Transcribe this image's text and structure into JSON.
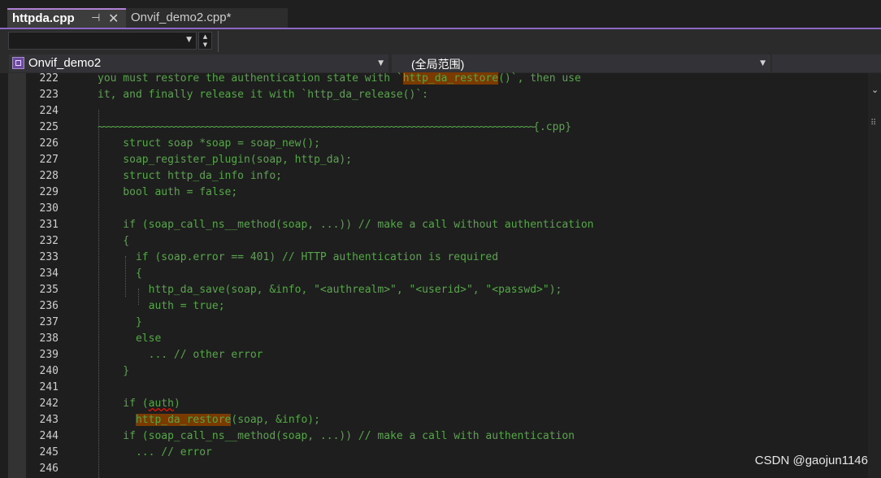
{
  "tabs": [
    {
      "label": "httpda.cpp",
      "active": true,
      "pinned": true
    },
    {
      "label": "Onvif_demo2.cpp*",
      "active": false
    }
  ],
  "icons": {
    "pin": "pin-icon",
    "close": "close-icon",
    "dropdown": "chevron-down-icon",
    "project": "project-icon",
    "spinner": "spinner-icon"
  },
  "navbar": {
    "project": "Onvif_demo2",
    "scope": "(全局范围)"
  },
  "colors": {
    "accent": "#8c67c7",
    "comment_green": "#57a64a",
    "highlight": "#7a3a00",
    "editor_bg": "#1e1e1e"
  },
  "editor": {
    "lines": [
      {
        "n": "222",
        "parts": [
          {
            "t": "you must restore the authentication state with `"
          },
          {
            "t": "http_da_restore",
            "hl": true
          },
          {
            "t": "()`, then use"
          }
        ]
      },
      {
        "n": "223",
        "parts": [
          {
            "t": "it, and finally release it with `http_da_release()`:"
          }
        ]
      },
      {
        "n": "224",
        "parts": [
          {
            "t": ""
          }
        ]
      },
      {
        "n": "225",
        "parts": [
          {
            "t": "~~~~~~~~~~~~~~~~~~~~~~~~~~~~~~~~~~~~~~~~~~~~~~~~~~~~~~~~~~~~~~~~~~~~~~~~~~~~~~~~~~~~~~~~~~~~~~~~~",
            "tilde": true
          },
          {
            "t": "{.cpp}"
          }
        ]
      },
      {
        "n": "226",
        "parts": [
          {
            "t": "    struct soap *soap = soap_new();"
          }
        ]
      },
      {
        "n": "227",
        "parts": [
          {
            "t": "    soap_register_plugin(soap, http_da);"
          }
        ]
      },
      {
        "n": "228",
        "parts": [
          {
            "t": "    struct http_da_info info;"
          }
        ]
      },
      {
        "n": "229",
        "parts": [
          {
            "t": "    bool auth = false;"
          }
        ]
      },
      {
        "n": "230",
        "parts": [
          {
            "t": ""
          }
        ]
      },
      {
        "n": "231",
        "parts": [
          {
            "t": "    if (soap_call_ns__method(soap, ...)) // make a call without authentication"
          }
        ]
      },
      {
        "n": "232",
        "parts": [
          {
            "t": "    {"
          }
        ]
      },
      {
        "n": "233",
        "parts": [
          {
            "t": "      if (soap.error == 401) // HTTP authentication is required"
          }
        ]
      },
      {
        "n": "234",
        "parts": [
          {
            "t": "      {"
          }
        ]
      },
      {
        "n": "235",
        "parts": [
          {
            "t": "        http_da_save(soap, &info, \"<authrealm>\", \"<userid>\", \"<passwd>\");"
          }
        ]
      },
      {
        "n": "236",
        "parts": [
          {
            "t": "        auth = true;"
          }
        ]
      },
      {
        "n": "237",
        "parts": [
          {
            "t": "      }"
          }
        ]
      },
      {
        "n": "238",
        "parts": [
          {
            "t": "      else"
          }
        ]
      },
      {
        "n": "239",
        "parts": [
          {
            "t": "        ... // other error"
          }
        ]
      },
      {
        "n": "240",
        "parts": [
          {
            "t": "    }"
          }
        ]
      },
      {
        "n": "241",
        "parts": [
          {
            "t": ""
          }
        ]
      },
      {
        "n": "242",
        "parts": [
          {
            "t": "    if ("
          },
          {
            "t": "auth",
            "squig": true
          },
          {
            "t": ")"
          }
        ]
      },
      {
        "n": "243",
        "parts": [
          {
            "t": "      "
          },
          {
            "t": "http_da_restore",
            "hl": true
          },
          {
            "t": "(soap, &info);"
          }
        ]
      },
      {
        "n": "244",
        "parts": [
          {
            "t": "    if (soap_call_ns__method(soap, ...)) // make a call with authentication"
          }
        ]
      },
      {
        "n": "245",
        "parts": [
          {
            "t": "      ... // error"
          }
        ]
      },
      {
        "n": "246",
        "parts": [
          {
            "t": ""
          }
        ]
      }
    ]
  },
  "watermark": "CSDN @gaojun1146"
}
